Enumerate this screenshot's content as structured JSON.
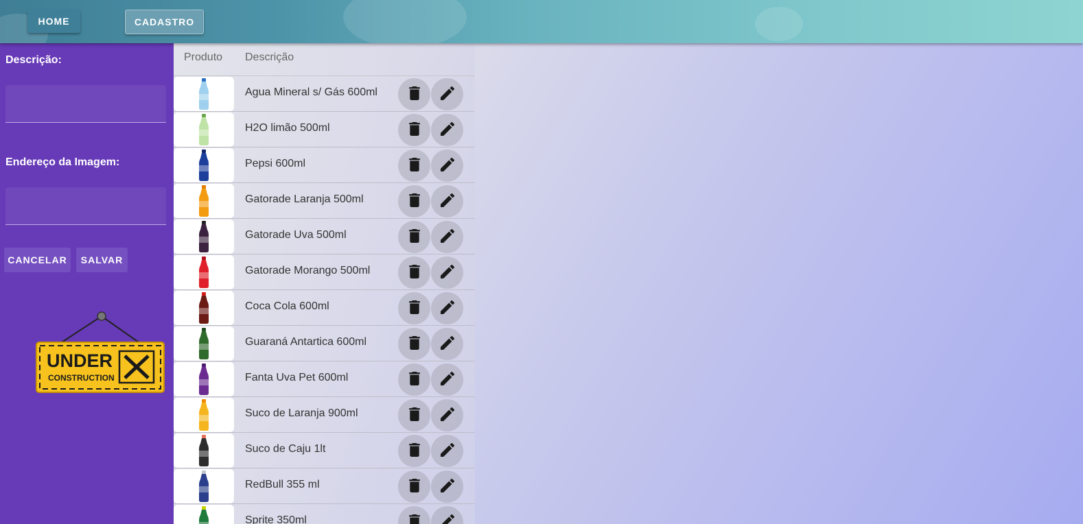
{
  "nav": {
    "home_label": "HOME",
    "cadastro_label": "CADASTRO"
  },
  "form": {
    "descricao_label": "Descrição:",
    "descricao_value": "",
    "imagem_label": "Endereço da Imagem:",
    "imagem_value": "",
    "cancel_label": "CANCELAR",
    "save_label": "SALVAR"
  },
  "badge": {
    "line1": "UNDER",
    "line2": "CONSTRUCTION"
  },
  "table": {
    "headers": {
      "produto": "Produto",
      "descricao": "Descrição"
    },
    "rows": [
      {
        "description": "Agua Mineral s/ Gás 600ml",
        "bottle_color": "#9fd0ee",
        "cap_color": "#2a6fc4"
      },
      {
        "description": "H2O limão 500ml",
        "bottle_color": "#bfe3a7",
        "cap_color": "#6aa84f"
      },
      {
        "description": "Pepsi 600ml",
        "bottle_color": "#1c3f9c",
        "cap_color": "#10256a"
      },
      {
        "description": "Gatorade Laranja 500ml",
        "bottle_color": "#f39c12",
        "cap_color": "#e08000"
      },
      {
        "description": "Gatorade Uva 500ml",
        "bottle_color": "#3b2240",
        "cap_color": "#222222"
      },
      {
        "description": "Gatorade Morango 500ml",
        "bottle_color": "#e0202a",
        "cap_color": "#b01018"
      },
      {
        "description": "Coca Cola 600ml",
        "bottle_color": "#6b1a14",
        "cap_color": "#d41e1e"
      },
      {
        "description": "Guaraná Antartica 600ml",
        "bottle_color": "#2f6b2a",
        "cap_color": "#1f4f1f"
      },
      {
        "description": "Fanta Uva Pet 600ml",
        "bottle_color": "#6b2c91",
        "cap_color": "#4d1a70"
      },
      {
        "description": "Suco de Laranja 900ml",
        "bottle_color": "#f5b51f",
        "cap_color": "#f08a00"
      },
      {
        "description": "Suco de Caju 1lt",
        "bottle_color": "#2d2d2d",
        "cap_color": "#e8705a"
      },
      {
        "description": "RedBull 355 ml",
        "bottle_color": "#2b3f8c",
        "cap_color": "#c0c4cc"
      },
      {
        "description": "Sprite 350ml",
        "bottle_color": "#1f7a3c",
        "cap_color": "#c8d400"
      }
    ]
  },
  "colors": {
    "sidebar": "#673ab7",
    "topbar": "#4d93a8"
  }
}
